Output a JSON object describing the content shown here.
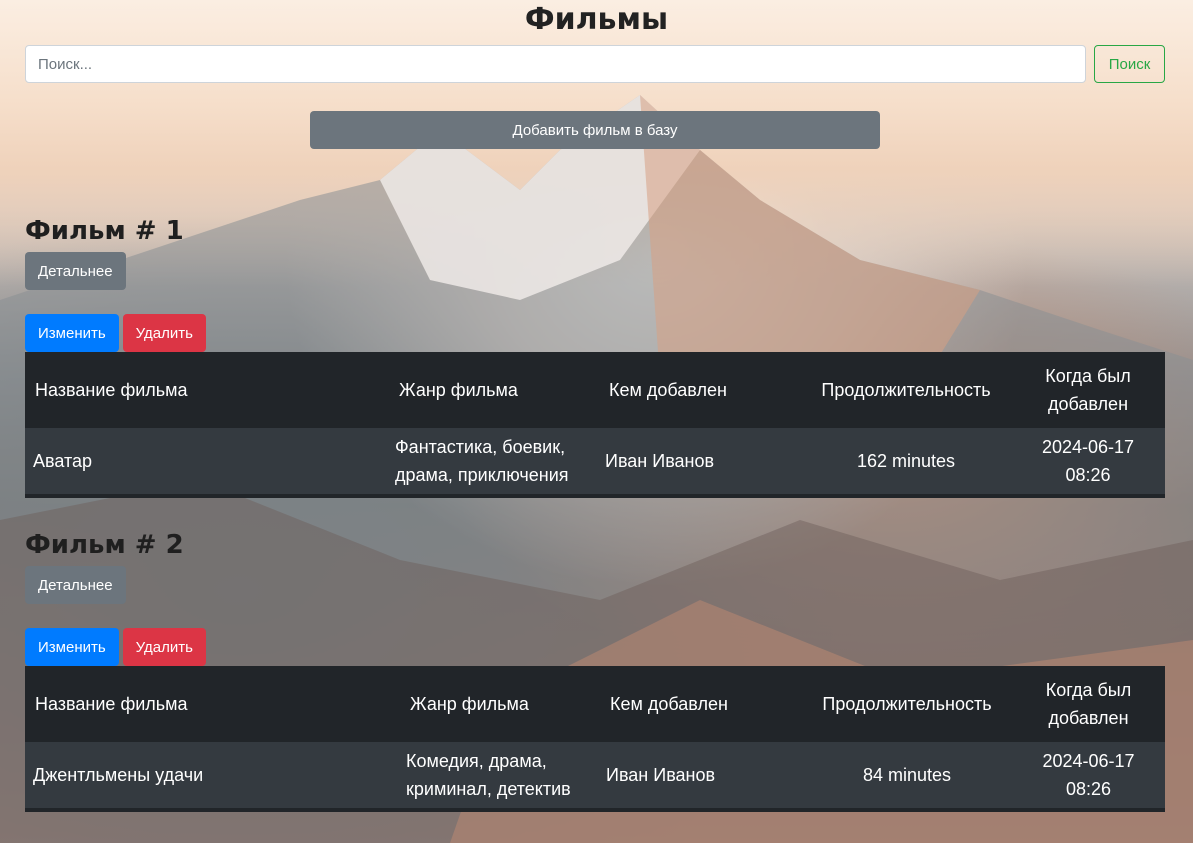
{
  "header": {
    "title": "Фильмы",
    "search_placeholder": "Поиск...",
    "search_button": "Поиск",
    "add_button": "Добавить фильм в базу"
  },
  "films": [
    {
      "heading": "Фильм # 1",
      "details_button": "Детальнее",
      "edit_button": "Изменить",
      "delete_button": "Удалить",
      "columns": [
        "Название фильма",
        "Жанр фильма",
        "Кем добавлен",
        "Продолжительность",
        "Когда был добавлен"
      ],
      "row": {
        "title": "Аватар",
        "genre": "Фантастика, боевик, драма, приключения",
        "added_by": "Иван Иванов",
        "duration": "162 minutes",
        "added_at": "2024-06-17 08:26"
      }
    },
    {
      "heading": "Фильм # 2",
      "details_button": "Детальнее",
      "edit_button": "Изменить",
      "delete_button": "Удалить",
      "columns": [
        "Название фильма",
        "Жанр фильма",
        "Кем добавлен",
        "Продолжительность",
        "Когда был добавлен"
      ],
      "row": {
        "title": "Джентльмены удачи",
        "genre": "Комедия, драма, криминал, детектив",
        "added_by": "Иван Иванов",
        "duration": "84 minutes",
        "added_at": "2024-06-17 08:26"
      }
    }
  ],
  "colors": {
    "secondary": "#6c757d",
    "primary": "#007bff",
    "danger": "#dc3545",
    "success": "#28a745",
    "table_dark": "#212529"
  }
}
